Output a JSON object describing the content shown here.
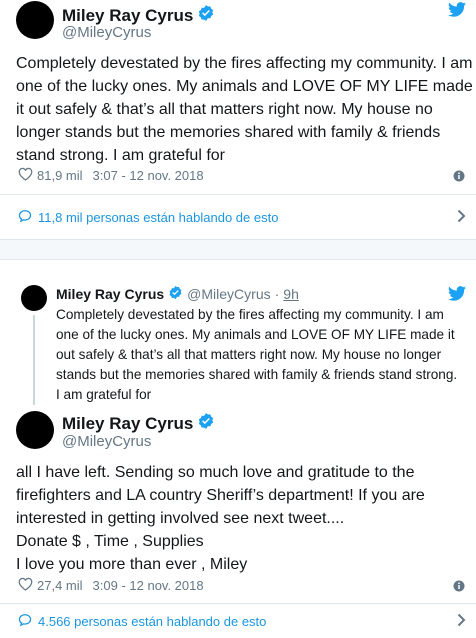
{
  "tweet1": {
    "author_name": "Miley Ray Cyrus",
    "author_handle": "@MileyCyrus",
    "text_lines": [
      "Completely devestated by the fires affecting my community. I am",
      "one of the lucky ones. My animals and LOVE OF MY LIFE made",
      "it out safely & that’s all that matters right now. My house no",
      "longer stands but the memories shared with family & friends",
      "stand strong. I am grateful for"
    ],
    "likes": "81,9 mil",
    "timestamp": "3:07 - 12 nov. 2018",
    "conversation": "11,8 mil personas están hablando de esto"
  },
  "quoted": {
    "author_name": "Miley Ray Cyrus",
    "author_handle": "@MileyCyrus",
    "separator": "·",
    "age": "9h",
    "text_lines": [
      "Completely devestated by the fires affecting my community. I am",
      "one of the lucky ones. My animals and LOVE OF MY LIFE made it",
      "out safely & that’s all that matters right now. My house no longer",
      "stands but the memories shared with family & friends stand strong.",
      "I am grateful for"
    ]
  },
  "tweet2": {
    "author_name": "Miley Ray Cyrus",
    "author_handle": "@MileyCyrus",
    "text_lines": [
      "all I have left. Sending so much love and gratitude to the",
      "firefighters and LA country Sheriff’s department!  If you are",
      "interested in getting involved see next tweet....",
      "Donate $ , Time , Supplies",
      "I love you more than ever , Miley"
    ],
    "likes": "27,4 mil",
    "timestamp": "3:09 - 12 nov. 2018",
    "conversation": "4.566 personas están hablando de esto"
  },
  "icons": {
    "verified": "verified-badge-icon",
    "bird": "twitter-bird-icon",
    "heart": "heart-icon",
    "info": "info-icon",
    "conversation": "conversation-bubble-icon",
    "chevron": "chevron-right-icon"
  },
  "colors": {
    "twitter_blue": "#1da1f2",
    "link_blue": "#1b95e0",
    "text": "#14171a",
    "muted": "#657786",
    "border": "#e1e8ed"
  }
}
